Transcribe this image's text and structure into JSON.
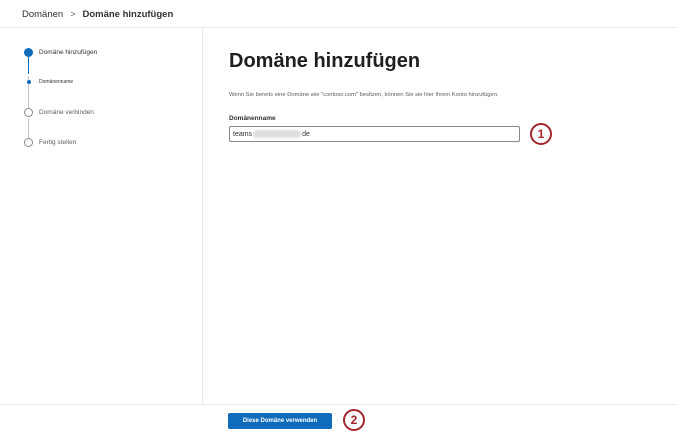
{
  "breadcrumb": {
    "parent": "Domänen",
    "separator": ">",
    "current": "Domäne hinzufügen"
  },
  "steps": [
    {
      "label": "Domäne hinzufügen",
      "state": "current"
    },
    {
      "label": "Domänenname",
      "state": "substep"
    },
    {
      "label": "Domäne verbinden",
      "state": "pending"
    },
    {
      "label": "Fertig stellen",
      "state": "pending"
    }
  ],
  "main": {
    "title": "Domäne hinzufügen",
    "description": "Wenn Sie bereits eine Domäne wie \"contoso.com\" besitzen, können Sie sie hier Ihrem Konto hinzufügen.",
    "field_label": "Domänenname",
    "input_prefix": "teams",
    "input_suffix": "de"
  },
  "footer": {
    "button_label": "Diese Domäne verwenden"
  },
  "markers": [
    "1",
    "2"
  ],
  "colors": {
    "accent": "#0f6cbd",
    "marker": "#a4262c"
  }
}
